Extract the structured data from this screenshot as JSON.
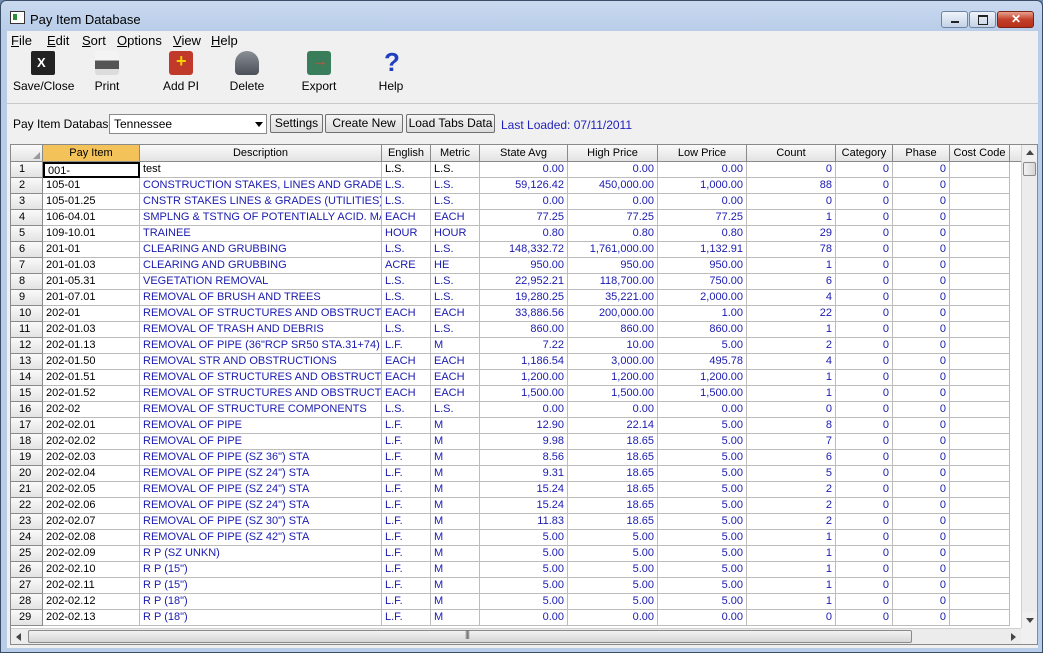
{
  "window": {
    "title": "Pay Item Database"
  },
  "menu": [
    "File",
    "Edit",
    "Sort",
    "Options",
    "View",
    "Help"
  ],
  "toolbar": [
    {
      "label": "Save/Close",
      "icon": "save-close-icon"
    },
    {
      "label": "Print",
      "icon": "printer-icon"
    },
    {
      "label": "Add PI",
      "icon": "add-item-icon"
    },
    {
      "label": "Delete",
      "icon": "delete-icon"
    },
    {
      "label": "Export",
      "icon": "export-icon"
    },
    {
      "label": "Help",
      "icon": "help-icon"
    }
  ],
  "database": {
    "label": "Pay Item Database:",
    "selected": "Tennessee",
    "settings_label": "Settings",
    "create_label": "Create New",
    "load_label": "Load Tabs Data",
    "last_loaded": "Last Loaded: 07/11/2011"
  },
  "grid": {
    "columns": [
      "Pay Item",
      "Description",
      "English",
      "Metric",
      "State Avg",
      "High Price",
      "Low Price",
      "Count",
      "Category",
      "Phase",
      "Cost Code"
    ],
    "rows": [
      [
        "001-",
        "test",
        "L.S.",
        "L.S.",
        "0.00",
        "0.00",
        "0.00",
        "0",
        "0",
        "0",
        ""
      ],
      [
        "105-01",
        "CONSTRUCTION STAKES, LINES AND GRADES",
        "L.S.",
        "L.S.",
        "59,126.42",
        "450,000.00",
        "1,000.00",
        "88",
        "0",
        "0",
        ""
      ],
      [
        "105-01.25",
        "CNSTR STAKES LINES & GRADES (UTILITIES)",
        "L.S.",
        "L.S.",
        "0.00",
        "0.00",
        "0.00",
        "0",
        "0",
        "0",
        ""
      ],
      [
        "106-04.01",
        "SMPLNG & TSTNG OF POTENTIALLY ACID. MA",
        "EACH",
        "EACH",
        "77.25",
        "77.25",
        "77.25",
        "1",
        "0",
        "0",
        ""
      ],
      [
        "109-10.01",
        "TRAINEE",
        "HOUR",
        "HOUR",
        "0.80",
        "0.80",
        "0.80",
        "29",
        "0",
        "0",
        ""
      ],
      [
        "201-01",
        "CLEARING AND GRUBBING",
        "L.S.",
        "L.S.",
        "148,332.72",
        "1,761,000.00",
        "1,132.91",
        "78",
        "0",
        "0",
        ""
      ],
      [
        "201-01.03",
        "CLEARING AND GRUBBING",
        "ACRE",
        "HE",
        "950.00",
        "950.00",
        "950.00",
        "1",
        "0",
        "0",
        ""
      ],
      [
        "201-05.31",
        "VEGETATION REMOVAL",
        "L.S.",
        "L.S.",
        "22,952.21",
        "118,700.00",
        "750.00",
        "6",
        "0",
        "0",
        ""
      ],
      [
        "201-07.01",
        "REMOVAL OF BRUSH AND TREES",
        "L.S.",
        "L.S.",
        "19,280.25",
        "35,221.00",
        "2,000.00",
        "4",
        "0",
        "0",
        ""
      ],
      [
        "202-01",
        "REMOVAL OF STRUCTURES AND OBSTRUCTIO",
        "EACH",
        "EACH",
        "33,886.56",
        "200,000.00",
        "1.00",
        "22",
        "0",
        "0",
        ""
      ],
      [
        "202-01.03",
        "REMOVAL OF TRASH AND DEBRIS",
        "L.S.",
        "L.S.",
        "860.00",
        "860.00",
        "860.00",
        "1",
        "0",
        "0",
        ""
      ],
      [
        "202-01.13",
        "REMOVAL OF PIPE (36\"RCP  SR50 STA.31+74)",
        "L.F.",
        "M",
        "7.22",
        "10.00",
        "5.00",
        "2",
        "0",
        "0",
        ""
      ],
      [
        "202-01.50",
        "REMOVAL STR AND OBSTRUCTIONS",
        "EACH",
        "EACH",
        "1,186.54",
        "3,000.00",
        "495.78",
        "4",
        "0",
        "0",
        ""
      ],
      [
        "202-01.51",
        "REMOVAL OF STRUCTURES AND OBSTRUCTI",
        "EACH",
        "EACH",
        "1,200.00",
        "1,200.00",
        "1,200.00",
        "1",
        "0",
        "0",
        ""
      ],
      [
        "202-01.52",
        "REMOVAL OF STRUCTURES AND OBSTRUCTI",
        "EACH",
        "EACH",
        "1,500.00",
        "1,500.00",
        "1,500.00",
        "1",
        "0",
        "0",
        ""
      ],
      [
        "202-02",
        "REMOVAL OF STRUCTURE COMPONENTS",
        "L.S.",
        "L.S.",
        "0.00",
        "0.00",
        "0.00",
        "0",
        "0",
        "0",
        ""
      ],
      [
        "202-02.01",
        "REMOVAL OF PIPE",
        "L.F.",
        "M",
        "12.90",
        "22.14",
        "5.00",
        "8",
        "0",
        "0",
        ""
      ],
      [
        "202-02.02",
        "REMOVAL OF PIPE",
        "L.F.",
        "M",
        "9.98",
        "18.65",
        "5.00",
        "7",
        "0",
        "0",
        ""
      ],
      [
        "202-02.03",
        "REMOVAL OF PIPE (SZ 36\") STA",
        "L.F.",
        "M",
        "8.56",
        "18.65",
        "5.00",
        "6",
        "0",
        "0",
        ""
      ],
      [
        "202-02.04",
        "REMOVAL OF PIPE (SZ 24\") STA",
        "L.F.",
        "M",
        "9.31",
        "18.65",
        "5.00",
        "5",
        "0",
        "0",
        ""
      ],
      [
        "202-02.05",
        "REMOVAL OF PIPE (SZ 24\") STA",
        "L.F.",
        "M",
        "15.24",
        "18.65",
        "5.00",
        "2",
        "0",
        "0",
        ""
      ],
      [
        "202-02.06",
        "REMOVAL OF PIPE (SZ 24\") STA",
        "L.F.",
        "M",
        "15.24",
        "18.65",
        "5.00",
        "2",
        "0",
        "0",
        ""
      ],
      [
        "202-02.07",
        "REMOVAL OF PIPE (SZ 30\") STA",
        "L.F.",
        "M",
        "11.83",
        "18.65",
        "5.00",
        "2",
        "0",
        "0",
        ""
      ],
      [
        "202-02.08",
        "REMOVAL OF PIPE (SZ 42\") STA",
        "L.F.",
        "M",
        "5.00",
        "5.00",
        "5.00",
        "1",
        "0",
        "0",
        ""
      ],
      [
        "202-02.09",
        "R P (SZ UNKN)",
        "L.F.",
        "M",
        "5.00",
        "5.00",
        "5.00",
        "1",
        "0",
        "0",
        ""
      ],
      [
        "202-02.10",
        "R P (15\")",
        "L.F.",
        "M",
        "5.00",
        "5.00",
        "5.00",
        "1",
        "0",
        "0",
        ""
      ],
      [
        "202-02.11",
        "R P (15\")",
        "L.F.",
        "M",
        "5.00",
        "5.00",
        "5.00",
        "1",
        "0",
        "0",
        ""
      ],
      [
        "202-02.12",
        "R P (18\")",
        "L.F.",
        "M",
        "5.00",
        "5.00",
        "5.00",
        "1",
        "0",
        "0",
        ""
      ],
      [
        "202-02.13",
        "R P (18\")",
        "L.F.",
        "M",
        "0.00",
        "0.00",
        "0.00",
        "0",
        "0",
        "0",
        ""
      ]
    ]
  }
}
